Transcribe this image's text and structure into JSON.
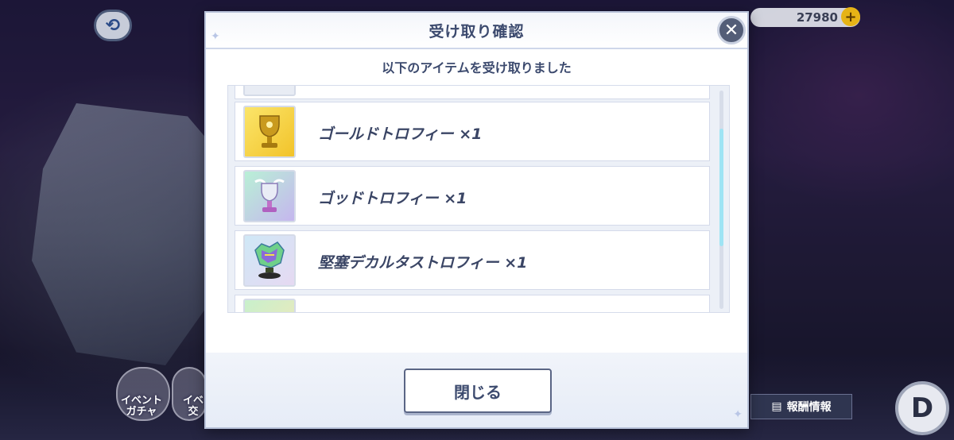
{
  "background": {
    "back_icon": "back-arrow-icon",
    "currency_amount": "27980",
    "plus_icon": "plus-icon",
    "event_gacha_label": "イベント\nガチャ",
    "event_exchange_label": "イベ\n交",
    "reward_info_label": "報酬情報",
    "d_button_label": "D"
  },
  "dialog": {
    "title": "受け取り確認",
    "close_icon": "close-x-icon",
    "subtitle": "以下のアイテムを受け取りました",
    "items": [
      {
        "label": "",
        "icon": "item-icon"
      },
      {
        "label": "ゴールドトロフィー ×1",
        "icon": "gold-trophy-icon"
      },
      {
        "label": "ゴッドトロフィー ×1",
        "icon": "god-trophy-icon"
      },
      {
        "label": "堅塞デカルタストロフィー ×1",
        "icon": "fortress-trophy-icon"
      },
      {
        "label": "",
        "icon": "card-item-icon"
      }
    ],
    "close_button_label": "閉じる"
  },
  "colors": {
    "accent_text": "#3c4a6e",
    "scrollbar": "#9fe4f4",
    "coin": "#e6b316"
  }
}
